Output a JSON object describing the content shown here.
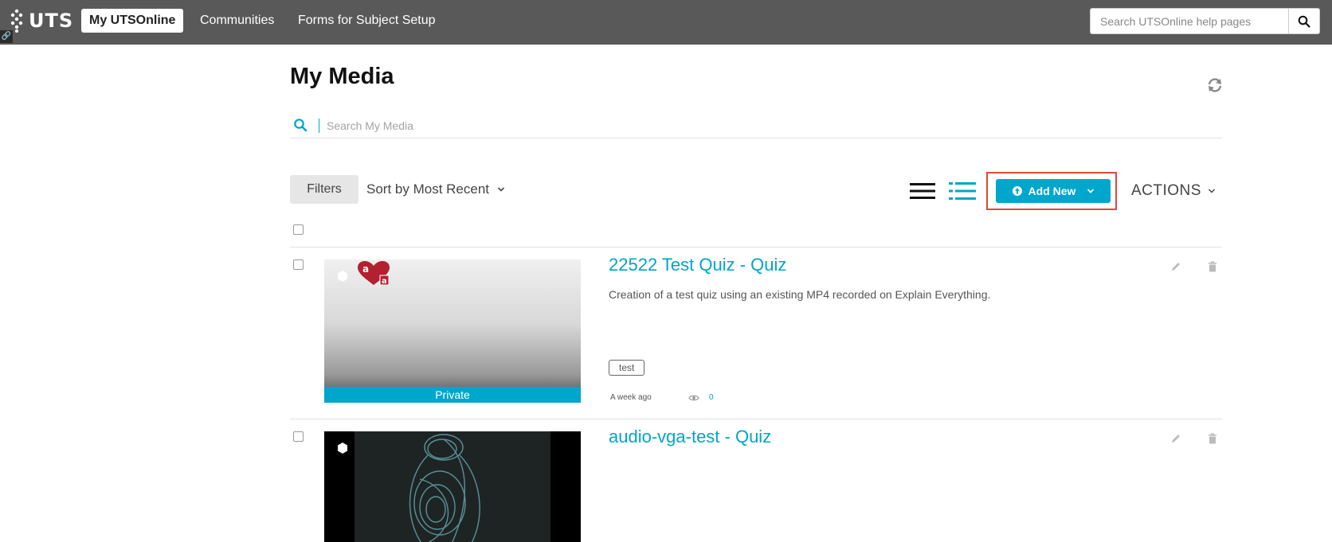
{
  "topbar": {
    "logo_text": "UTS",
    "tabs": [
      {
        "label": "My UTSOnline",
        "active": true
      },
      {
        "label": "Communities",
        "active": false
      },
      {
        "label": "Forms for Subject Setup",
        "active": false
      }
    ],
    "help_search_placeholder": "Search UTSOnline help pages"
  },
  "page": {
    "title": "My Media",
    "search_placeholder": "Search My Media"
  },
  "toolbar": {
    "filters_label": "Filters",
    "sort_label": "Sort by Most Recent",
    "add_new_label": "Add New",
    "actions_label": "ACTIONS"
  },
  "entries": [
    {
      "title": "22522 Test Quiz - Quiz",
      "description": "Creation of a test quiz using an existing MP4 recorded on Explain Everything.",
      "tag": "test",
      "date": "A week ago",
      "views": "0",
      "privacy": "Private"
    },
    {
      "title": "audio-vga-test - Quiz"
    }
  ],
  "colors": {
    "accent": "#00a7cc",
    "topbar": "#595959",
    "highlight_border": "#e0483b"
  }
}
